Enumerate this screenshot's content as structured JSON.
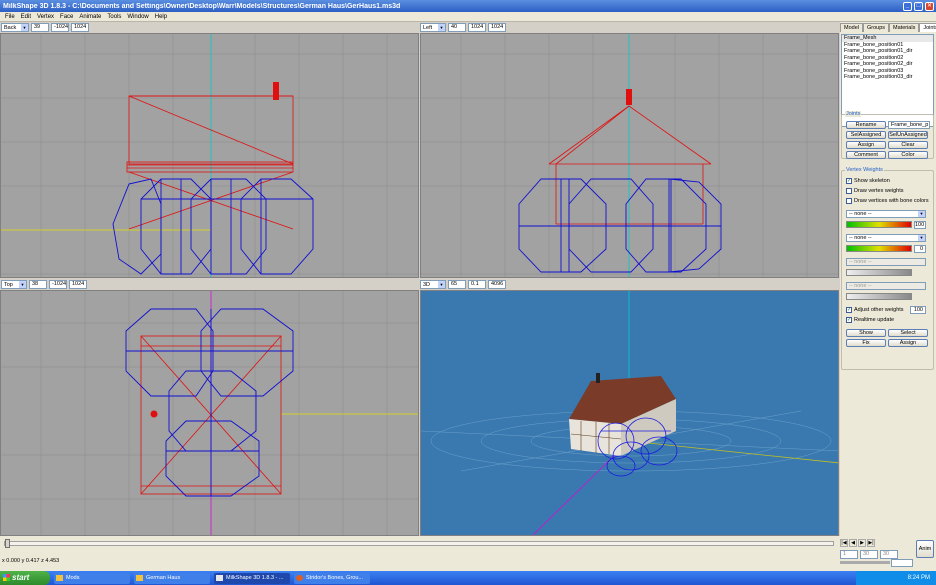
{
  "window": {
    "title": "MilkShape 3D 1.8.3 - C:\\Documents and Settings\\Owner\\Desktop\\Warr\\Models\\Structures\\German Haus\\GerHaus1.ms3d"
  },
  "menu": [
    "File",
    "Edit",
    "Vertex",
    "Face",
    "Animate",
    "Tools",
    "Window",
    "Help"
  ],
  "viewports": {
    "back": {
      "view": "Back",
      "zoom": "39",
      "min": "-1024",
      "max": "1024"
    },
    "left": {
      "view": "Left",
      "zoom": "40",
      "min": "1024",
      "max": "1024"
    },
    "top": {
      "view": "Top",
      "zoom": "38",
      "min": "-1024",
      "max": "1024"
    },
    "persp": {
      "view": "3D",
      "zoom": "65",
      "min": "0.1",
      "max": "4096"
    }
  },
  "panel": {
    "tabs": [
      "Model",
      "Groups",
      "Materials",
      "Joints"
    ],
    "joints": [
      "Frame_Mesh",
      "Frame_bone_position01",
      "Frame_bone_position01_dir",
      "Frame_bone_position02",
      "Frame_bone_position02_dir",
      "Frame_bone_position03",
      "Frame_bone_position03_dir"
    ],
    "joints_group": {
      "label": "Joints",
      "rename": "Rename",
      "name_value": "Frame_bone_p",
      "sel_assigned": "SelAssigned",
      "sel_unassigned": "SelUnAssigned",
      "assign": "Assign",
      "clear": "Clear",
      "comment": "Comment",
      "color": "Color"
    },
    "weights_group": {
      "label": "Vertex Weights",
      "show_skeleton": "Show skeleton",
      "draw_weights": "Draw vertex weights",
      "draw_bone_colors": "Draw vertices with bone colors",
      "none": "-- none --",
      "w1": "100",
      "w2": "0",
      "adjust_other": "Adjust other weights",
      "adjust_value": "100",
      "realtime": "Realtime update",
      "show": "Show",
      "select": "Select",
      "fix": "Fix",
      "assign": "Assign"
    }
  },
  "bottom": {
    "status": "x 0.000 y 0.417 z 4.453",
    "anim": "Anim",
    "frame_a": "1",
    "frame_b": "30",
    "frame_c": "30"
  },
  "taskbar": {
    "start": "start",
    "tasks": [
      "Mods",
      "German Haus",
      "MilkShape 3D 1.8.3 - ...",
      "Stridor's Bones, Grou..."
    ],
    "clock": "8:24 PM"
  }
}
